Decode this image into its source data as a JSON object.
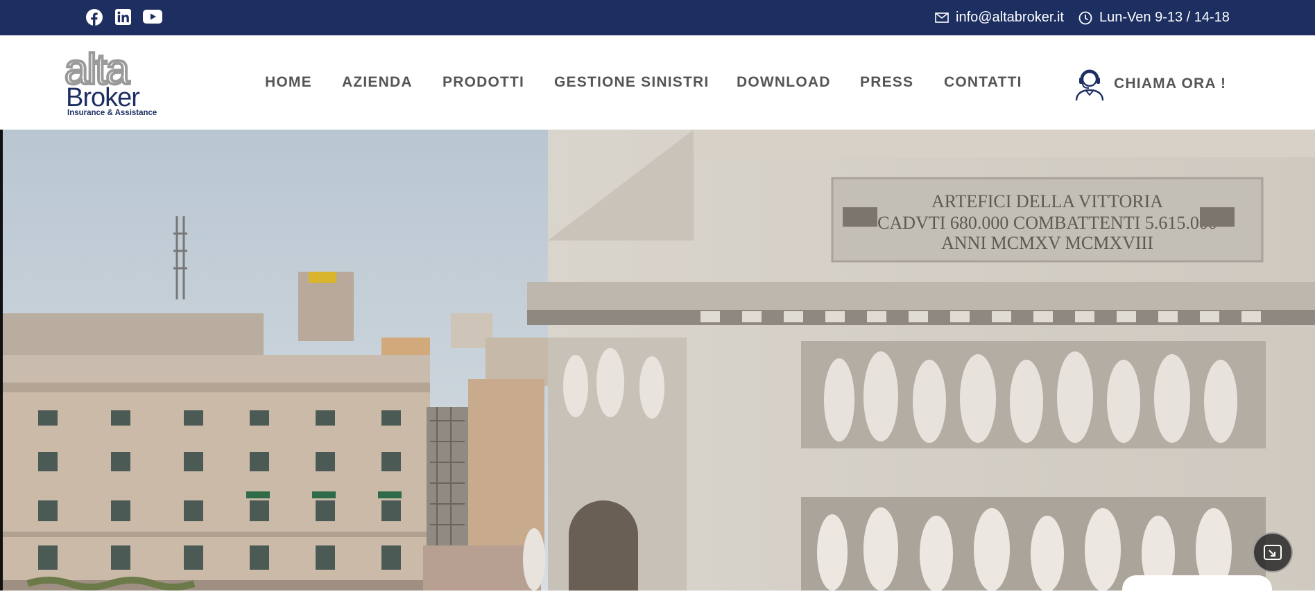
{
  "topbar": {
    "social": [
      {
        "name": "facebook-icon"
      },
      {
        "name": "linkedin-icon"
      },
      {
        "name": "youtube-icon"
      }
    ],
    "email": "info@altabroker.it",
    "hours": "Lun-Ven 9-13 / 14-18",
    "bg_color": "#1d2f61"
  },
  "logo": {
    "line1": "alta",
    "line2": "Broker",
    "tagline": "Insurance & Assistance"
  },
  "nav": {
    "items": [
      {
        "label": "HOME"
      },
      {
        "label": "AZIENDA"
      },
      {
        "label": "PRODOTTI"
      },
      {
        "label": "GESTIONE SINISTRI"
      },
      {
        "label": "DOWNLOAD"
      },
      {
        "label": "PRESS"
      },
      {
        "label": "CONTATTI"
      }
    ]
  },
  "call": {
    "label": "CHIAMA ORA !"
  },
  "hero": {
    "inscription": [
      "ARTEFICI DELLA VITTORIA",
      "CADVTI 680.000 COMBATTENTI 5.615.000",
      "ANNI MCMXV MCMXVIII"
    ]
  }
}
